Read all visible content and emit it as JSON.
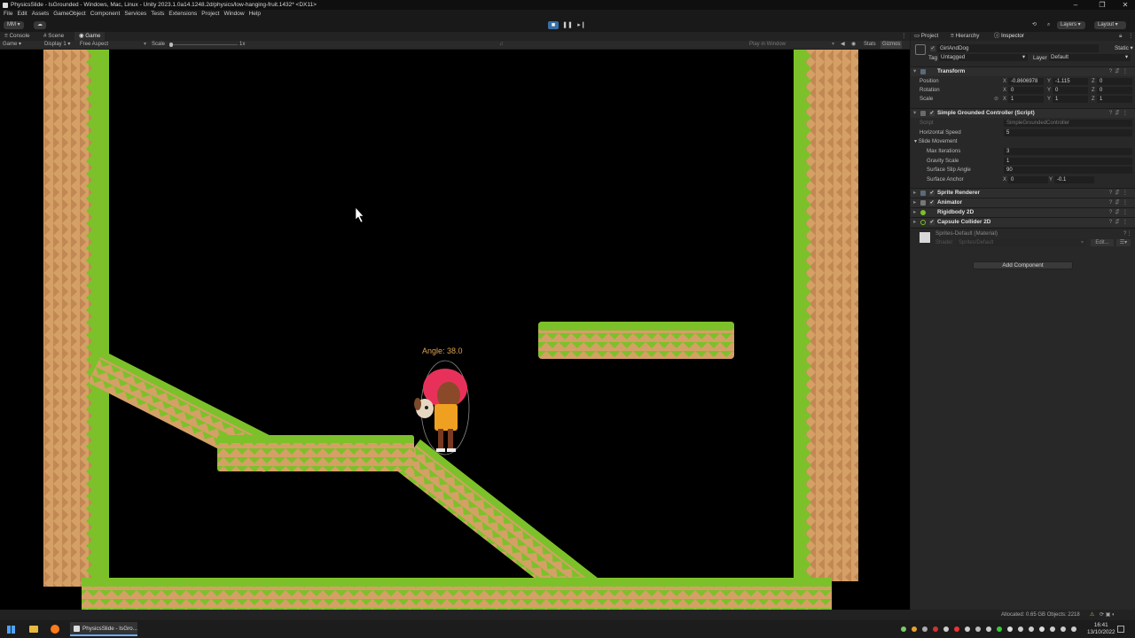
{
  "window": {
    "title": "PhysicsSlide - IsGrounded - Windows, Mac, Linux - Unity 2023.1.0a14.1248.2d/physics/low-hanging-fruit.1432* <DX11>",
    "controls": [
      "–",
      "❐",
      "✕"
    ]
  },
  "menu": [
    "File",
    "Edit",
    "Assets",
    "GameObject",
    "Component",
    "Services",
    "Tests",
    "Extensions",
    "Project",
    "Window",
    "Help"
  ],
  "toolbar": {
    "account": "MM",
    "layers": "Layers",
    "layout": "Layout"
  },
  "left_tabs": [
    "Console",
    "Scene",
    "Game"
  ],
  "game_bar": {
    "mode": "Game",
    "display": "Display 1",
    "aspect": "Free Aspect",
    "scale_label": "Scale",
    "scale_value": "1x",
    "play_in_window": "Play in Window",
    "stats": "Stats",
    "gizmos": "Gizmos"
  },
  "game": {
    "angle_label": "Angle: 38.0"
  },
  "inspector": {
    "tabs": [
      "Project",
      "Hierarchy",
      "Inspector"
    ],
    "object_name": "GirlAndDog",
    "static_label": "Static",
    "tag_label": "Tag",
    "tag_value": "Untagged",
    "layer_label": "Layer",
    "layer_value": "Default",
    "transform": {
      "title": "Transform",
      "position_label": "Position",
      "rotation_label": "Rotation",
      "scale_label": "Scale",
      "position": [
        "-0.8606978",
        "-1.115",
        "0"
      ],
      "rotation": [
        "0",
        "0",
        "0"
      ],
      "scale": [
        "1",
        "1",
        "1"
      ]
    },
    "controller": {
      "title": "Simple Grounded Controller (Script)",
      "script_label": "Script",
      "script_value": "SimpleGroundedController",
      "horizontal_speed_label": "Horizontal Speed",
      "horizontal_speed": "5",
      "slide_movement_label": "Slide Movement",
      "max_iterations_label": "Max Iterations",
      "max_iterations": "3",
      "gravity_scale_label": "Gravity Scale",
      "gravity_scale": "1",
      "surface_slip_label": "Surface Slip Angle",
      "surface_slip": "90",
      "surface_anchor_label": "Surface Anchor",
      "surface_anchor": [
        "0",
        "-0.1"
      ]
    },
    "components": [
      "Sprite Renderer",
      "Animator",
      "Rigidbody 2D",
      "Capsule Collider 2D"
    ],
    "material": {
      "name": "Sprites-Default (Material)",
      "shader_label": "Shader",
      "shader_value": "Sprites/Default",
      "edit_label": "Edit..."
    },
    "add_component": "Add Component"
  },
  "status": {
    "allocated": "Allocated: 0.65 GB Objects: 2218"
  },
  "taskbar": {
    "app_label": "PhysicsSlide - IsGro...",
    "time": "16:41",
    "date": "13/10/2022"
  },
  "colors": {
    "grass": "#7cc12a",
    "dirt": "#d5a066",
    "dirt_zig": "#c28854",
    "angle_text": "#e0a050",
    "hair": "#e8315a"
  }
}
